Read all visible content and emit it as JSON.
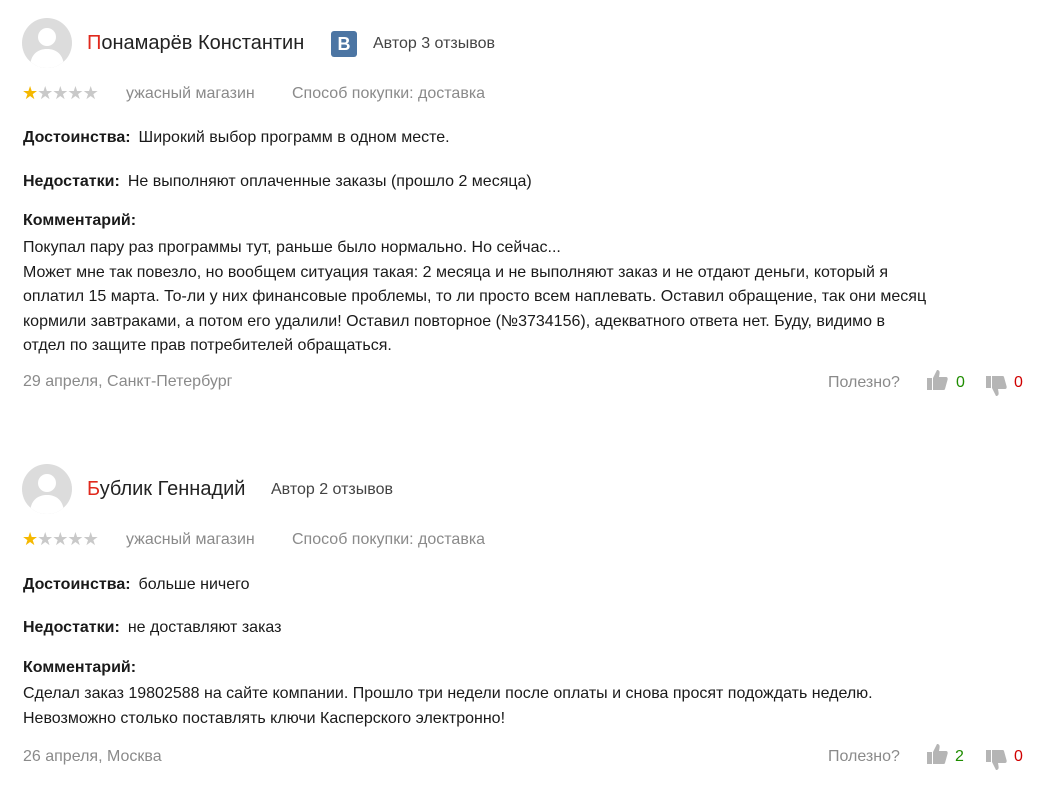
{
  "reviews": [
    {
      "author_initial": "П",
      "author_rest": "онамарёв Константин",
      "social_badge": "B",
      "author_reviews": "Автор 3 отзывов",
      "rating": 1,
      "rating_max": 5,
      "rating_label": "ужасный магазин",
      "purchase_method": "Способ покупки: доставка",
      "pros_label": "Достоинства:",
      "pros": "Широкий выбор программ в одном месте.",
      "cons_label": "Недостатки:",
      "cons": "Не выполняют оплаченные заказы (прошло 2 месяца)",
      "comment_label": "Комментарий:",
      "comment_lines": [
        "Покупал пару раз программы тут, раньше было нормально. Но сейчас...",
        "Может мне так повезло, но вообщем ситуация такая: 2 месяца и не выполняют заказ и не отдают деньги, который я",
        "оплатил 15 марта. То-ли у них финансовые проблемы, то ли просто всем наплевать. Оставил обращение, так они месяц",
        "кормили завтраками, а потом его удалили! Оставил повторное (№3734156), адекватного ответа нет. Буду, видимо в",
        "отдел по защите прав потребителей обращаться."
      ],
      "date_location": "29 апреля, Санкт-Петербург",
      "useful_label": "Полезно?",
      "likes": "0",
      "dislikes": "0"
    },
    {
      "author_initial": "Б",
      "author_rest": "ублик Геннадий",
      "author_reviews": "Автор 2 отзывов",
      "rating": 1,
      "rating_max": 5,
      "rating_label": "ужасный магазин",
      "purchase_method": "Способ покупки: доставка",
      "pros_label": "Достоинства:",
      "pros": "больше ничего",
      "cons_label": "Недостатки:",
      "cons": "не доставляют заказ",
      "comment_label": "Комментарий:",
      "comment_lines": [
        "Сделал заказ 19802588 на сайте компании. Прошло три недели после оплаты и снова просят подождать неделю.",
        "Невозможно столько поставлять ключи Касперского электронно!"
      ],
      "date_location": "26 апреля, Москва",
      "useful_label": "Полезно?",
      "likes": "2",
      "dislikes": "0"
    }
  ],
  "colors": {
    "star_active": "#f5b800",
    "star_inactive": "#c9c9c9",
    "initial_red": "#e0291d",
    "vk_blue": "#4c75a3",
    "likes_green": "#1f8d00",
    "dislikes_red": "#d00000"
  },
  "icons": [
    "avatar-placeholder-icon",
    "vk-icon",
    "star-icon",
    "thumbs-up-icon",
    "thumbs-down-icon"
  ]
}
